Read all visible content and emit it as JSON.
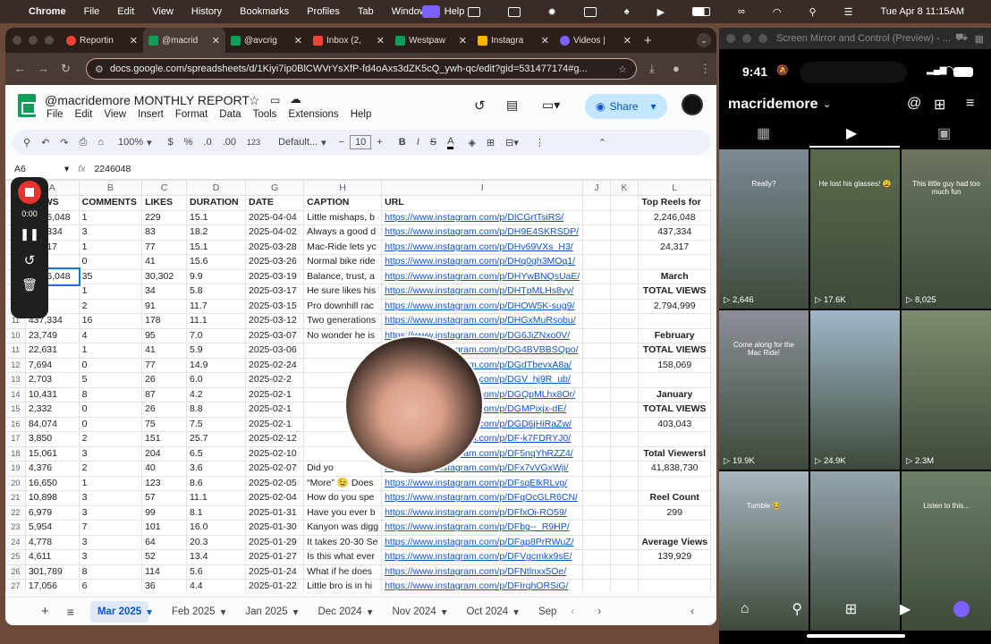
{
  "menubar": {
    "apple": "",
    "items": [
      "Chrome",
      "File",
      "Edit",
      "View",
      "History",
      "Bookmarks",
      "Profiles",
      "Tab",
      "Window",
      "Help"
    ],
    "datetime": "Tue Apr 8  11:15AM"
  },
  "browser": {
    "tabs": [
      {
        "label": "Reportin",
        "color": "#ea4335"
      },
      {
        "label": "@macrid",
        "color": "#0f9d58"
      },
      {
        "label": "@avcrig",
        "color": "#0f9d58"
      },
      {
        "label": "Inbox (2,",
        "color": "#ea4335"
      },
      {
        "label": "Westpaw",
        "color": "#0f9d58"
      },
      {
        "label": "Instagra",
        "color": "#f4b400"
      },
      {
        "label": "Videos |",
        "color": "#7b61ff"
      }
    ],
    "url": "docs.google.com/spreadsheets/d/1Kiyi7ip0BlCWVrYsXfP-fd4oAxs3dZK5cQ_ywh-qc/edit?gid=531477174#g..."
  },
  "doc": {
    "title": "@macridemore MONTHLY REPORT",
    "menu": [
      "File",
      "Edit",
      "View",
      "Insert",
      "Format",
      "Data",
      "Tools",
      "Extensions",
      "Help"
    ],
    "share": "Share"
  },
  "toolbar": {
    "zoom": "100%",
    "currency": "$",
    "percent": "%",
    "dec1": ".0",
    "dec2": ".00",
    "num": "123",
    "font": "Default...",
    "size": "10",
    "bold": "B",
    "italic": "I",
    "strike": "S",
    "underline": "A"
  },
  "formula": {
    "cellref": "A6",
    "fx": "fx",
    "value": "2246048"
  },
  "columns": [
    "A",
    "B",
    "C",
    "D",
    "G",
    "H",
    "I",
    "J",
    "K",
    "L"
  ],
  "headers": [
    "VIEWS",
    "COMMENTS",
    "LIKES",
    "DURATION",
    "DATE",
    "CAPTION",
    "URL",
    "",
    "",
    "Top Reels for"
  ],
  "rows": [
    {
      "n": "4",
      "v": [
        "2,246,048",
        "1",
        "229",
        "15.1",
        "2025-04-04",
        "Little mishaps, b",
        "https://www.instagram.com/p/DICGrtTsiRS/",
        "",
        "",
        "2,246,048"
      ]
    },
    {
      "n": "5",
      "v": [
        "437,334",
        "3",
        "83",
        "18.2",
        "2025-04-02",
        "Always a good d",
        "https://www.instagram.com/p/DH9E4SKRSDP/",
        "",
        "",
        "437,334"
      ]
    },
    {
      "n": "6",
      "v": [
        "24,317",
        "1",
        "77",
        "15.1",
        "2025-03-28",
        "Mac-Ride lets yc",
        "https://www.instagram.com/p/DHv69VXs_H3/",
        "",
        "",
        "24,317"
      ]
    },
    {
      "n": "7",
      "v": [
        "317",
        "0",
        "41",
        "15.6",
        "2025-03-26",
        "Normal bike ride",
        "https://www.instagram.com/p/DHq0qh3MOq1/",
        "",
        "",
        ""
      ]
    },
    {
      "n": "8",
      "v": [
        "2,246,048",
        "35",
        "30,302",
        "9.9",
        "2025-03-19",
        "Balance, trust, a",
        "https://www.instagram.com/p/DHYwBNQsUaE/",
        "",
        "",
        "March"
      ]
    },
    {
      "n": "9",
      "v": [
        "129",
        "1",
        "34",
        "5.8",
        "2025-03-17",
        "He sure likes his",
        "https://www.instagram.com/p/DHTpMLHs8vy/",
        "",
        "",
        "TOTAL VIEWS"
      ]
    },
    {
      "n": "10",
      "v": [
        "12",
        "2",
        "91",
        "11.7",
        "2025-03-15",
        "Pro downhill rac",
        "https://www.instagram.com/p/DHOW5K-sug9/",
        "",
        "",
        "2,794,999"
      ]
    },
    {
      "n": "11",
      "v": [
        "437,334",
        "16",
        "178",
        "11.1",
        "2025-03-12",
        "Two generations",
        "https://www.instagram.com/p/DHGxMuRsobu/",
        "",
        "",
        ""
      ]
    },
    {
      "n": "10",
      "v": [
        "23,749",
        "4",
        "95",
        "7.0",
        "2025-03-07",
        "No wonder he is",
        "https://www.instagram.com/p/DG6JiZNxo0V/",
        "",
        "",
        "February"
      ]
    },
    {
      "n": "11",
      "v": [
        "22,631",
        "1",
        "41",
        "5.9",
        "2025-03-06",
        "",
        "https://www.instagram.com/p/DG4BVBBSQpo/",
        "",
        "",
        "TOTAL VIEWS"
      ]
    },
    {
      "n": "12",
      "v": [
        "7,694",
        "0",
        "77",
        "14.9",
        "2025-02-24",
        "",
        "https://www.instagram.com/p/DGdTbevxA8a/",
        "",
        "",
        "158,069"
      ]
    },
    {
      "n": "13",
      "v": [
        "2,703",
        "5",
        "26",
        "6.0",
        "2025-02-2",
        "",
        "https://www.instagram.com/p/DGV_hj9R_ub/",
        "",
        "",
        ""
      ]
    },
    {
      "n": "14",
      "v": [
        "10,431",
        "8",
        "87",
        "4.2",
        "2025-02-1",
        "",
        "https://www.instagram.com/p/DGQpMLhx8Or/",
        "",
        "",
        "January"
      ]
    },
    {
      "n": "15",
      "v": [
        "2,332",
        "0",
        "26",
        "8.8",
        "2025-02-1",
        "",
        "https://www.instagram.com/p/DGMPixjx-dE/",
        "",
        "",
        "TOTAL VIEWS"
      ]
    },
    {
      "n": "16",
      "v": [
        "84,074",
        "0",
        "75",
        "7.5",
        "2025-02-1",
        "",
        "https://www.instagram.com/p/DGD6jHiRaZw/",
        "",
        "",
        "403,043"
      ]
    },
    {
      "n": "17",
      "v": [
        "3,850",
        "2",
        "151",
        "25.7",
        "2025-02-12",
        "",
        "https://www.instagram.com/p/DF-k7FDRYJ0/",
        "",
        "",
        ""
      ]
    },
    {
      "n": "18",
      "v": [
        "15,061",
        "3",
        "204",
        "6.5",
        "2025-02-10",
        "",
        "https://www.instagram.com/p/DF5nqYhRZZ4/",
        "",
        "",
        "Total Viewersl"
      ]
    },
    {
      "n": "19",
      "v": [
        "4,376",
        "2",
        "40",
        "3.6",
        "2025-02-07",
        "Did yo",
        "https://www.instagram.com/p/DFx7vVGxWji/",
        "",
        "",
        "41,838,730"
      ]
    },
    {
      "n": "20",
      "v": [
        "16,650",
        "1",
        "123",
        "8.6",
        "2025-02-05",
        "“More” 😉 Does",
        "https://www.instagram.com/p/DFsqElkRLvg/",
        "",
        "",
        ""
      ]
    },
    {
      "n": "21",
      "v": [
        "10,898",
        "3",
        "57",
        "11.1",
        "2025-02-04",
        "How do you spe",
        "https://www.instagram.com/p/DFqOcGLR6CN/",
        "",
        "",
        "Reel Count"
      ]
    },
    {
      "n": "22",
      "v": [
        "6,979",
        "3",
        "99",
        "8.1",
        "2025-01-31",
        "Have you ever b",
        "https://www.instagram.com/p/DFfxOi-RO59/",
        "",
        "",
        "299"
      ]
    },
    {
      "n": "23",
      "v": [
        "5,954",
        "7",
        "101",
        "16.0",
        "2025-01-30",
        "Kanyon was digg",
        "https://www.instagram.com/p/DFbg--_R9HP/",
        "",
        "",
        ""
      ]
    },
    {
      "n": "24",
      "v": [
        "4,778",
        "3",
        "64",
        "20.3",
        "2025-01-29",
        "It takes 20-30 Se",
        "https://www.instagram.com/p/DFap8PrRWuZ/",
        "",
        "",
        "Average Views"
      ]
    },
    {
      "n": "25",
      "v": [
        "4,611",
        "3",
        "52",
        "13.4",
        "2025-01-27",
        "Is this what ever",
        "https://www.instagram.com/p/DFVgcmkx9sE/",
        "",
        "",
        "139,929"
      ]
    },
    {
      "n": "26",
      "v": [
        "301,789",
        "8",
        "114",
        "5.6",
        "2025-01-24",
        "What if he does",
        "https://www.instagram.com/p/DFNtlnxx5Oe/",
        "",
        "",
        ""
      ]
    },
    {
      "n": "27",
      "v": [
        "17,056",
        "6",
        "36",
        "4.4",
        "2025-01-22",
        "Little bro is in hi",
        "https://www.instagram.com/p/DFIrqhORSiG/",
        "",
        "",
        ""
      ]
    }
  ],
  "sheets": [
    "Mar 2025",
    "Feb 2025",
    "Jan 2025",
    "Dec 2024",
    "Nov 2024",
    "Oct 2024",
    "Sep"
  ],
  "recorder": {
    "time": "0:00"
  },
  "phone": {
    "window_title": "Screen Mirror and Control (Preview) - ...",
    "time": "9:41",
    "profile": "macridemore",
    "thumbs": [
      {
        "count": "2,646",
        "cap": "Really?",
        "bg": "#7d8a95"
      },
      {
        "count": "17.6K",
        "cap": "He lost his glasses! 😩",
        "bg": "#5b6a4b"
      },
      {
        "count": "8,025",
        "cap": "This little guy had too much fun",
        "bg": "#6b7560"
      },
      {
        "count": "19.9K",
        "cap": "Come along for the Mac Ride!",
        "bg": "#8a8f97"
      },
      {
        "count": "24.9K",
        "cap": "",
        "bg": "#9fb7c9"
      },
      {
        "count": "2.3M",
        "cap": "",
        "bg": "#7d8b6e"
      },
      {
        "count": "",
        "cap": "Tumble 😂",
        "bg": "#a9b4bf"
      },
      {
        "count": "",
        "cap": "",
        "bg": "#93a3ae"
      },
      {
        "count": "",
        "cap": "Listen to this...",
        "bg": "#6e7f68"
      }
    ]
  }
}
